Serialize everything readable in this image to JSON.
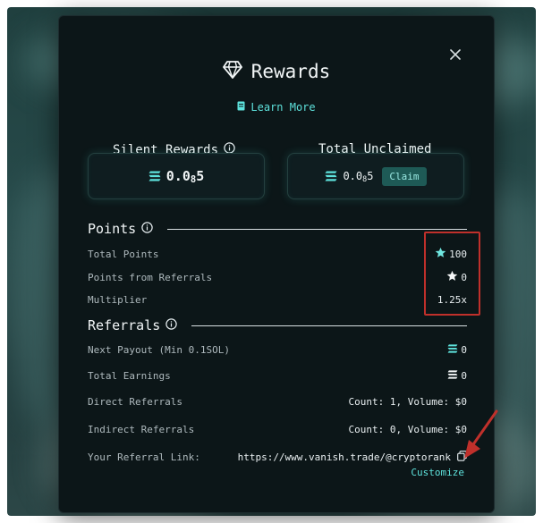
{
  "modal": {
    "title": "Rewards",
    "learn_more": "Learn More"
  },
  "columns": {
    "silent": {
      "label": "Silent Rewards",
      "value_main": "0.0",
      "value_sub": "8",
      "value_end": "5"
    },
    "unclaimed": {
      "label": "Total Unclaimed",
      "value_main": "0.0",
      "value_sub": "8",
      "value_end": "5",
      "claim_label": "Claim"
    }
  },
  "points": {
    "heading": "Points",
    "rows": [
      {
        "label": "Total Points",
        "value": "100",
        "icon": "star-icon"
      },
      {
        "label": "Points from Referrals",
        "value": "0",
        "icon": "star-icon"
      },
      {
        "label": "Multiplier",
        "value": "1.25x"
      }
    ]
  },
  "referrals": {
    "heading": "Referrals",
    "next_payout_label": "Next Payout (Min 0.1SOL)",
    "next_payout_value": "0",
    "total_earnings_label": "Total Earnings",
    "total_earnings_value": "0",
    "direct_label": "Direct Referrals",
    "direct_value": "Count: 1, Volume: $0",
    "indirect_label": "Indirect Referrals",
    "indirect_value": "Count: 0, Volume: $0",
    "link_label": "Your Referral Link:",
    "link_value": "https://www.vanish.trade/@cryptorank",
    "customize_label": "Customize"
  },
  "colors": {
    "accent": "#5ee2dc",
    "highlight": "#c0302b"
  }
}
